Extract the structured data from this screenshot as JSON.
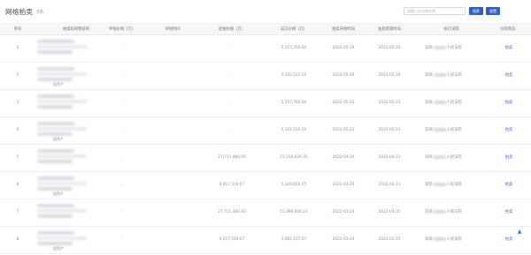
{
  "header": {
    "title": "网络拍卖",
    "count": "8条"
  },
  "search": {
    "placeholder": "请输入标的物名称",
    "search_label": "搜索",
    "reset_label": "重置"
  },
  "columns": [
    "序号",
    "拍卖标的物名称",
    "评估价格（元）",
    "评估时间",
    "起拍价格（元）",
    "成交价格（元）",
    "拍卖开始时间",
    "拍卖结束时间",
    "执行法院",
    "标的状态"
  ],
  "rows": [
    {
      "idx": "1",
      "tail": "",
      "appraisal": "-",
      "appraisal_time": "",
      "start_price": "-",
      "deal_price": "5,557,760.00",
      "start": "2022-05-19",
      "end": "2022-05-20",
      "court_pre": "深圳",
      "court_post": "人民法院",
      "status": "拍卖"
    },
    {
      "idx": "2",
      "tail": "租赁产",
      "appraisal": "-",
      "appraisal_time": "",
      "start_price": "-",
      "deal_price": "5,102,521.50",
      "start": "2022-05-19",
      "end": "2022-05-20",
      "court_pre": "深圳",
      "court_post": "人民法院",
      "status": "拍卖"
    },
    {
      "idx": "3",
      "tail": "",
      "appraisal": "-",
      "appraisal_time": "",
      "start_price": "-",
      "deal_price": "5,557,760.00",
      "start": "2022-05-22",
      "end": "2022-05-23",
      "court_pre": "深圳",
      "court_post": "人民法院",
      "status": "拍卖"
    },
    {
      "idx": "4",
      "tail": "租赁产",
      "appraisal": "-",
      "appraisal_time": "",
      "start_price": "-",
      "deal_price": "5,102,533.50",
      "start": "2022-05-22",
      "end": "2022-05-23",
      "court_pre": "深圳",
      "court_post": "人民法院",
      "status": "拍卖"
    },
    {
      "idx": "5",
      "tail": "",
      "appraisal": "-",
      "appraisal_time": "",
      "start_price": "27,711,480.00",
      "deal_price": "15,316,626.35",
      "start": "2022-04-20",
      "end": "2022-04-21",
      "court_pre": "深圳",
      "court_post": "人民法院",
      "status": "拍卖"
    },
    {
      "idx": "6",
      "tail": "租赁产",
      "appraisal": "-",
      "appraisal_time": "",
      "start_price": "9,017,519.67",
      "deal_price": "5,329,656.45",
      "start": "2022-04-20",
      "end": "2022-04-21",
      "court_pre": "深圳",
      "court_post": "人民法院",
      "status": "拍卖"
    },
    {
      "idx": "7",
      "tail": "",
      "appraisal": "-",
      "appraisal_time": "",
      "start_price": "27,711,480.00",
      "deal_price": "15,388,006.23",
      "start": "2022-03-24",
      "end": "2022-03-25",
      "court_pre": "深圳",
      "court_post": "人民法院",
      "status": "拍卖"
    },
    {
      "idx": "8",
      "tail": "租赁产",
      "appraisal": "-",
      "appraisal_time": "",
      "start_price": "9,017,519.67",
      "deal_price": "5,062,127.57",
      "start": "2022-03-24",
      "end": "2022-03-25",
      "court_pre": "深圳",
      "court_post": "人民法院",
      "status": "拍卖"
    }
  ],
  "back_to_top_icon": "arrow-up-icon",
  "accent": "#2f5ec8"
}
